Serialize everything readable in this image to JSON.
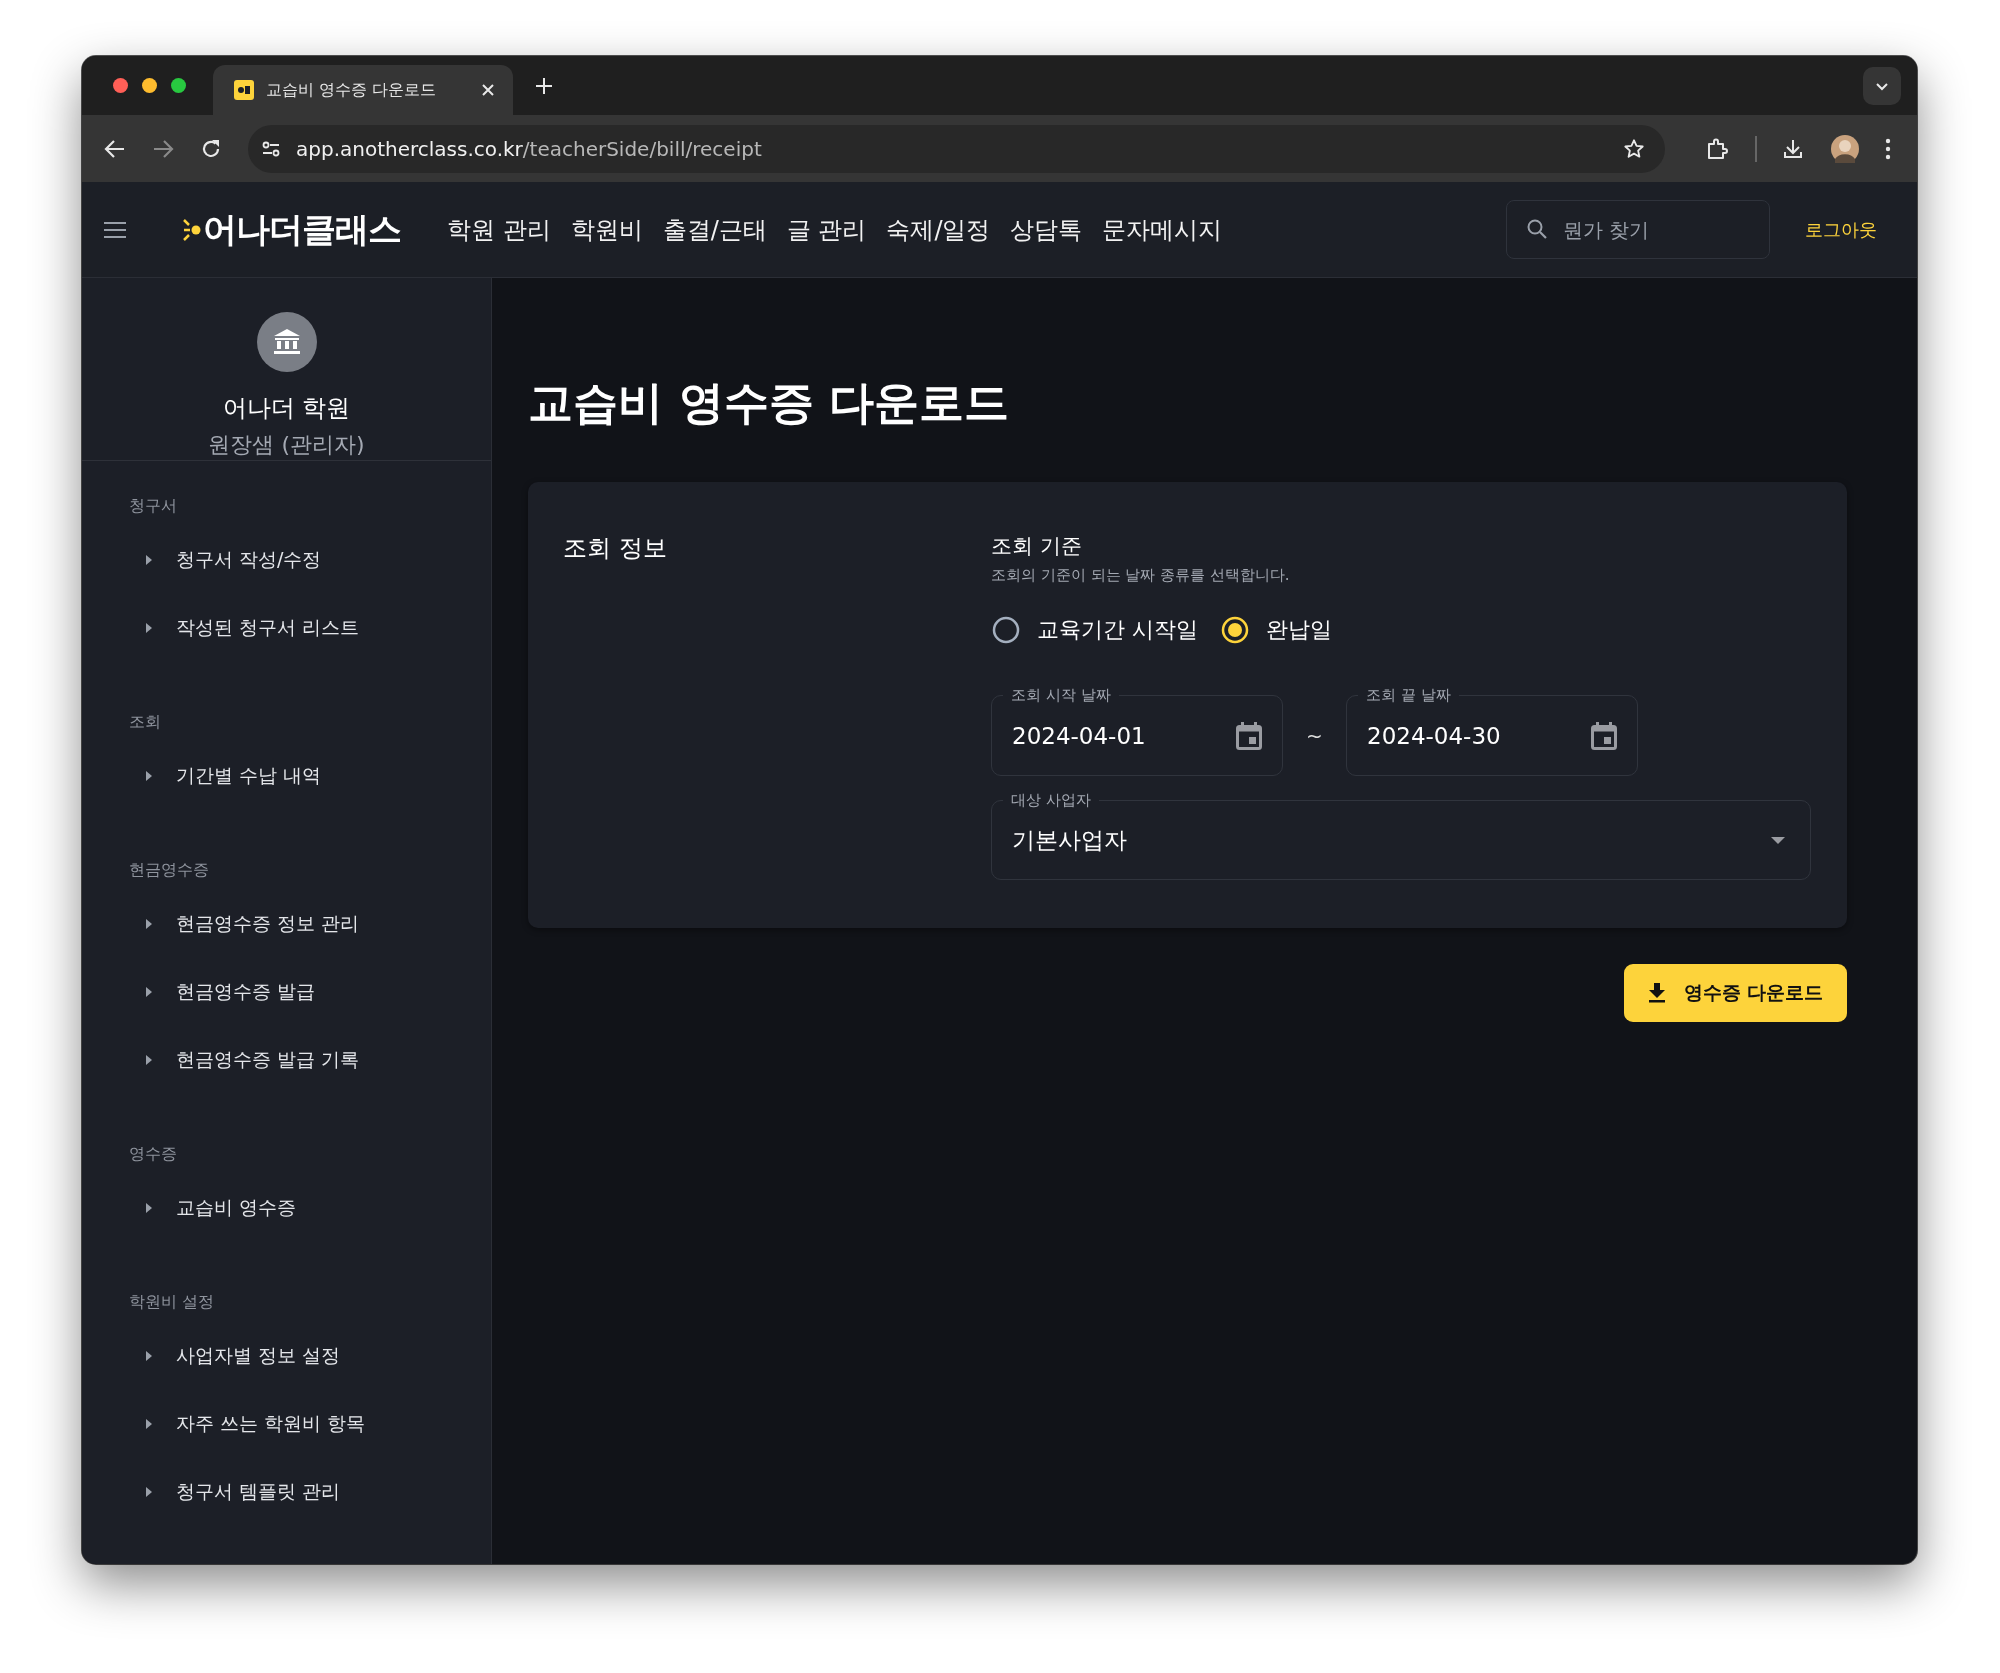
{
  "browser": {
    "tab_title": "교습비 영수증 다운로드",
    "url_host": "app.anotherclass.co.kr",
    "url_path": "/teacherSide/bill/receipt"
  },
  "header": {
    "logo": "어나더클래스",
    "nav": [
      {
        "label": "학원 관리"
      },
      {
        "label": "학원비"
      },
      {
        "label": "출결/근태"
      },
      {
        "label": "글 관리"
      },
      {
        "label": "숙제/일정"
      },
      {
        "label": "상담톡"
      },
      {
        "label": "문자메시지"
      }
    ],
    "search": {
      "placeholder": "뭔가 찾기"
    },
    "logout": "로그아웃"
  },
  "sidebar": {
    "org_name": "어나더 학원",
    "role": "원장샘 (관리자)",
    "sections": [
      {
        "title": "청구서",
        "items": [
          "청구서 작성/수정",
          "작성된 청구서 리스트"
        ]
      },
      {
        "title": "조회",
        "items": [
          "기간별 수납 내역"
        ]
      },
      {
        "title": "현금영수증",
        "items": [
          "현금영수증 정보 관리",
          "현금영수증 발급",
          "현금영수증 발급 기록"
        ]
      },
      {
        "title": "영수증",
        "items": [
          "교습비 영수증"
        ]
      },
      {
        "title": "학원비 설정",
        "items": [
          "사업자별 정보 설정",
          "자주 쓰는 학원비 항목",
          "청구서 템플릿 관리"
        ]
      }
    ]
  },
  "main": {
    "title": "교습비 영수증 다운로드",
    "card": {
      "section_label": "조회 정보",
      "criteria_label": "조회 기준",
      "criteria_help": "조회의 기준이 되는 날짜 종류를 선택합니다.",
      "radios": [
        {
          "label": "교육기간 시작일",
          "selected": false
        },
        {
          "label": "완납일",
          "selected": true
        }
      ],
      "date_fields": [
        {
          "label": "조회 시작 날짜",
          "value": "2024-04-01"
        },
        {
          "label": "조회 끝 날짜",
          "value": "2024-04-30"
        }
      ],
      "range_separator": "~",
      "select": {
        "label": "대상 사업자",
        "value": "기본사업자"
      }
    },
    "download_button": "영수증 다운로드"
  }
}
